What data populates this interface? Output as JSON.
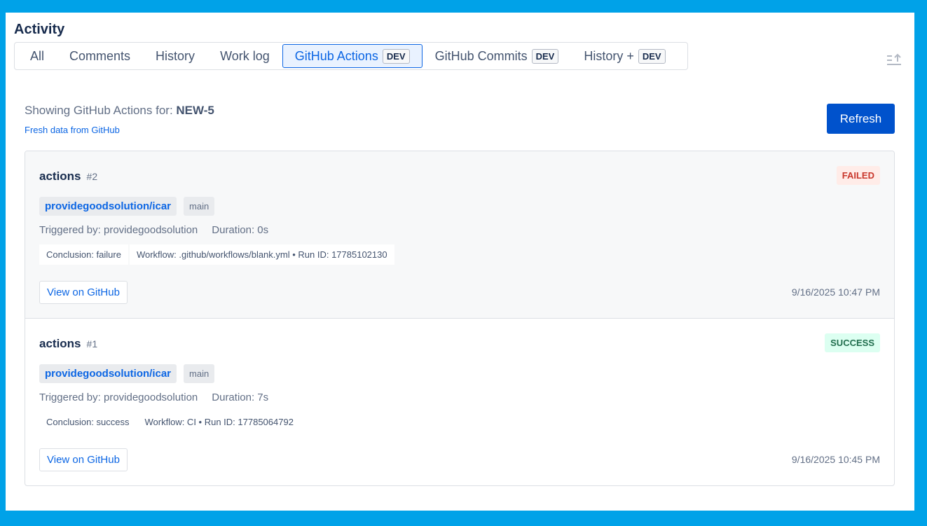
{
  "title": "Activity",
  "tabs": [
    {
      "label": "All"
    },
    {
      "label": "Comments"
    },
    {
      "label": "History"
    },
    {
      "label": "Work log"
    },
    {
      "label": "GitHub Actions",
      "badge": "DEV"
    },
    {
      "label": "GitHub Commits",
      "badge": "DEV"
    },
    {
      "label": "History +",
      "badge": "DEV"
    }
  ],
  "header": {
    "showing_prefix": "Showing GitHub Actions for:",
    "issue_key": "NEW-5",
    "fresh": "Fresh data from GitHub",
    "refresh": "Refresh"
  },
  "runs": [
    {
      "name": "actions",
      "number": "#2",
      "status": "FAILED",
      "repo": "providegoodsolution/icar",
      "branch": "main",
      "triggered": "Triggered by: providegoodsolution",
      "duration": "Duration: 0s",
      "conclusion": "Conclusion: failure",
      "workflow": "Workflow: .github/workflows/blank.yml • Run ID: 17785102130",
      "view": "View on GitHub",
      "time": "9/16/2025 10:47 PM"
    },
    {
      "name": "actions",
      "number": "#1",
      "status": "SUCCESS",
      "repo": "providegoodsolution/icar",
      "branch": "main",
      "triggered": "Triggered by: providegoodsolution",
      "duration": "Duration: 7s",
      "conclusion": "Conclusion: success",
      "workflow": "Workflow: CI • Run ID: 17785064792",
      "view": "View on GitHub",
      "time": "9/16/2025 10:45 PM"
    }
  ]
}
